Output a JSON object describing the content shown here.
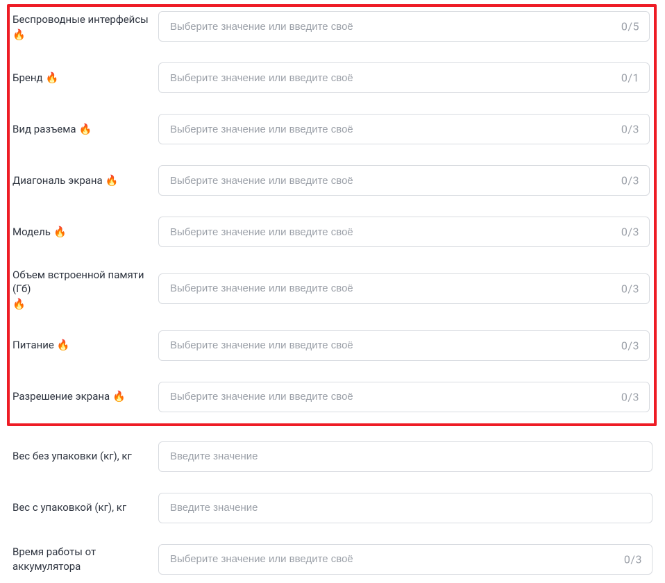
{
  "placeholders": {
    "select": "Выберите значение или введите своё",
    "enter": "Введите значение"
  },
  "highlighted": [
    {
      "label": "Беспроводные интерфейсы",
      "fire": true,
      "counter": "0/5"
    },
    {
      "label": "Бренд",
      "fire": true,
      "counter": "0/1"
    },
    {
      "label": "Вид разъема",
      "fire": true,
      "counter": "0/3"
    },
    {
      "label": "Диагональ экрана",
      "fire": true,
      "counter": "0/3"
    },
    {
      "label": "Модель",
      "fire": true,
      "counter": "0/3"
    },
    {
      "label": "Объем встроенной памяти (Гб)",
      "fire": true,
      "counter": "0/3"
    },
    {
      "label": "Питание",
      "fire": true,
      "counter": "0/3"
    },
    {
      "label": "Разрешение экрана",
      "fire": true,
      "counter": "0/3"
    }
  ],
  "rest": [
    {
      "label": "Вес без упаковки (кг), кг",
      "fire": false,
      "placeholder_key": "enter",
      "counter": ""
    },
    {
      "label": "Вес с упаковкой (кг), кг",
      "fire": false,
      "placeholder_key": "enter",
      "counter": ""
    },
    {
      "label": "Время работы от аккумулятора",
      "fire": false,
      "placeholder_key": "select",
      "counter": "0/3"
    }
  ]
}
